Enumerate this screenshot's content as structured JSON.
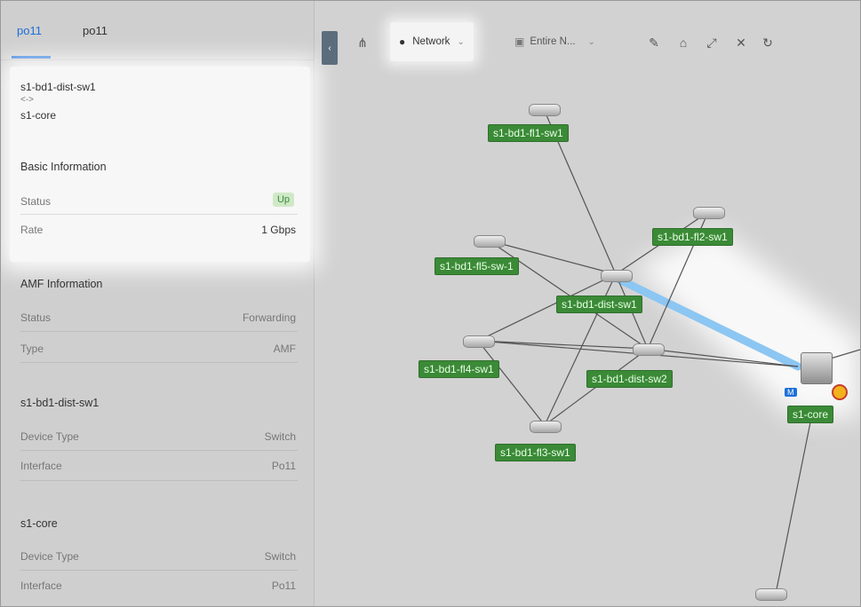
{
  "tabs": [
    {
      "label": "po11",
      "active": true
    },
    {
      "label": "po11",
      "active": false
    }
  ],
  "link": {
    "from": "s1-bd1-dist-sw1",
    "arrow": "<->",
    "to": "s1-core"
  },
  "basic_info": {
    "title": "Basic Information",
    "rows": [
      {
        "label": "Status",
        "value": "Up"
      },
      {
        "label": "Rate",
        "value": "1 Gbps"
      }
    ]
  },
  "amf_info": {
    "title": "AMF Information",
    "rows": [
      {
        "label": "Status",
        "value": "Forwarding"
      },
      {
        "label": "Type",
        "value": "AMF"
      }
    ]
  },
  "endpoint_a": {
    "title": "s1-bd1-dist-sw1",
    "rows": [
      {
        "label": "Device Type",
        "value": "Switch"
      },
      {
        "label": "Interface",
        "value": "Po11"
      }
    ]
  },
  "endpoint_b": {
    "title": "s1-core",
    "rows": [
      {
        "label": "Device Type",
        "value": "Switch"
      },
      {
        "label": "Interface",
        "value": "Po11"
      }
    ]
  },
  "toolbar": {
    "collapse_icon": "chevron-left-icon",
    "network_label": "Network",
    "scope_label": "Entire N...",
    "icons": [
      "topology-icon",
      "network-icon",
      "scope-icon",
      "edit-icon",
      "lock-icon",
      "expand-icon",
      "collapse-icon",
      "redo-icon"
    ]
  },
  "topology": {
    "nodes": [
      "s1-bd1-fl1-sw1",
      "s1-bd1-fl2-sw1",
      "s1-bd1-fl5-sw-1",
      "s1-bd1-dist-sw1",
      "s1-bd1-fl4-sw1",
      "s1-bd1-dist-sw2",
      "s1-bd1-fl3-sw1",
      "s1-core"
    ],
    "core_badge": "M",
    "colors": {
      "label_bg": "#3b8a37",
      "highlight": "#7fbef0",
      "tab_active": "#1e6fd9",
      "status_up": "#3c8a3a"
    }
  }
}
